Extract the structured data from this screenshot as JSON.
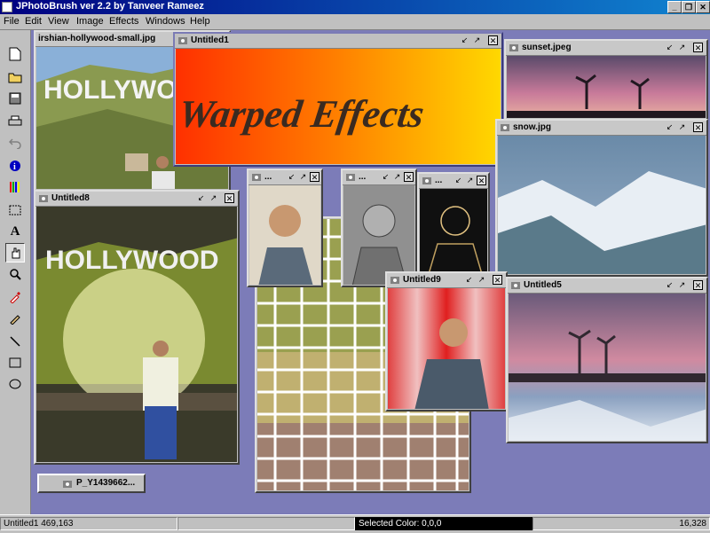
{
  "app": {
    "title": "JPhotoBrush  ver 2.2 by Tanveer Rameez"
  },
  "window_controls": [
    "minimize-icon",
    "restore-icon",
    "close-icon"
  ],
  "menu": [
    {
      "label": "File",
      "mnemonic": "F"
    },
    {
      "label": "Edit",
      "mnemonic": "E"
    },
    {
      "label": "View",
      "mnemonic": "V"
    },
    {
      "label": "Image",
      "mnemonic": "I"
    },
    {
      "label": "Effects",
      "mnemonic": "f"
    },
    {
      "label": "Windows",
      "mnemonic": "W"
    },
    {
      "label": "Help",
      "mnemonic": "H"
    }
  ],
  "tools": [
    "new-file-icon",
    "open-folder-icon",
    "save-icon",
    "print-icon",
    "undo-icon",
    "info-icon",
    "color-bars-icon",
    "rect-select-icon",
    "text-tool-icon",
    "hand-tool-icon",
    "zoom-icon",
    "eyedropper-icon",
    "brush-icon",
    "line-tool-icon",
    "rectangle-tool-icon",
    "ellipse-tool-icon"
  ],
  "windows": {
    "hollywood_small": {
      "title": "irshian-hollywood-small.jpg",
      "sign": "HOLLYWOOD"
    },
    "untitled1": {
      "title": "Untitled1",
      "text": "Warped Effects"
    },
    "sunset": {
      "title": "sunset.jpeg"
    },
    "snow": {
      "title": "snow.jpg"
    },
    "untitled8": {
      "title": "Untitled8",
      "sign": "HOLLYWOOD"
    },
    "w_portrait1": {
      "title": "..."
    },
    "w_portrait2": {
      "title": "..."
    },
    "w_portrait3": {
      "title": "..."
    },
    "untitled9": {
      "title": "Untitled9"
    },
    "untitled5": {
      "title": "Untitled5"
    },
    "minimized": {
      "title": "P_Y1439662..."
    }
  },
  "status": {
    "window_info": "Untitled1  469,163",
    "selected_color": "Selected  Color: 0,0,0",
    "zoom": "16,328"
  }
}
